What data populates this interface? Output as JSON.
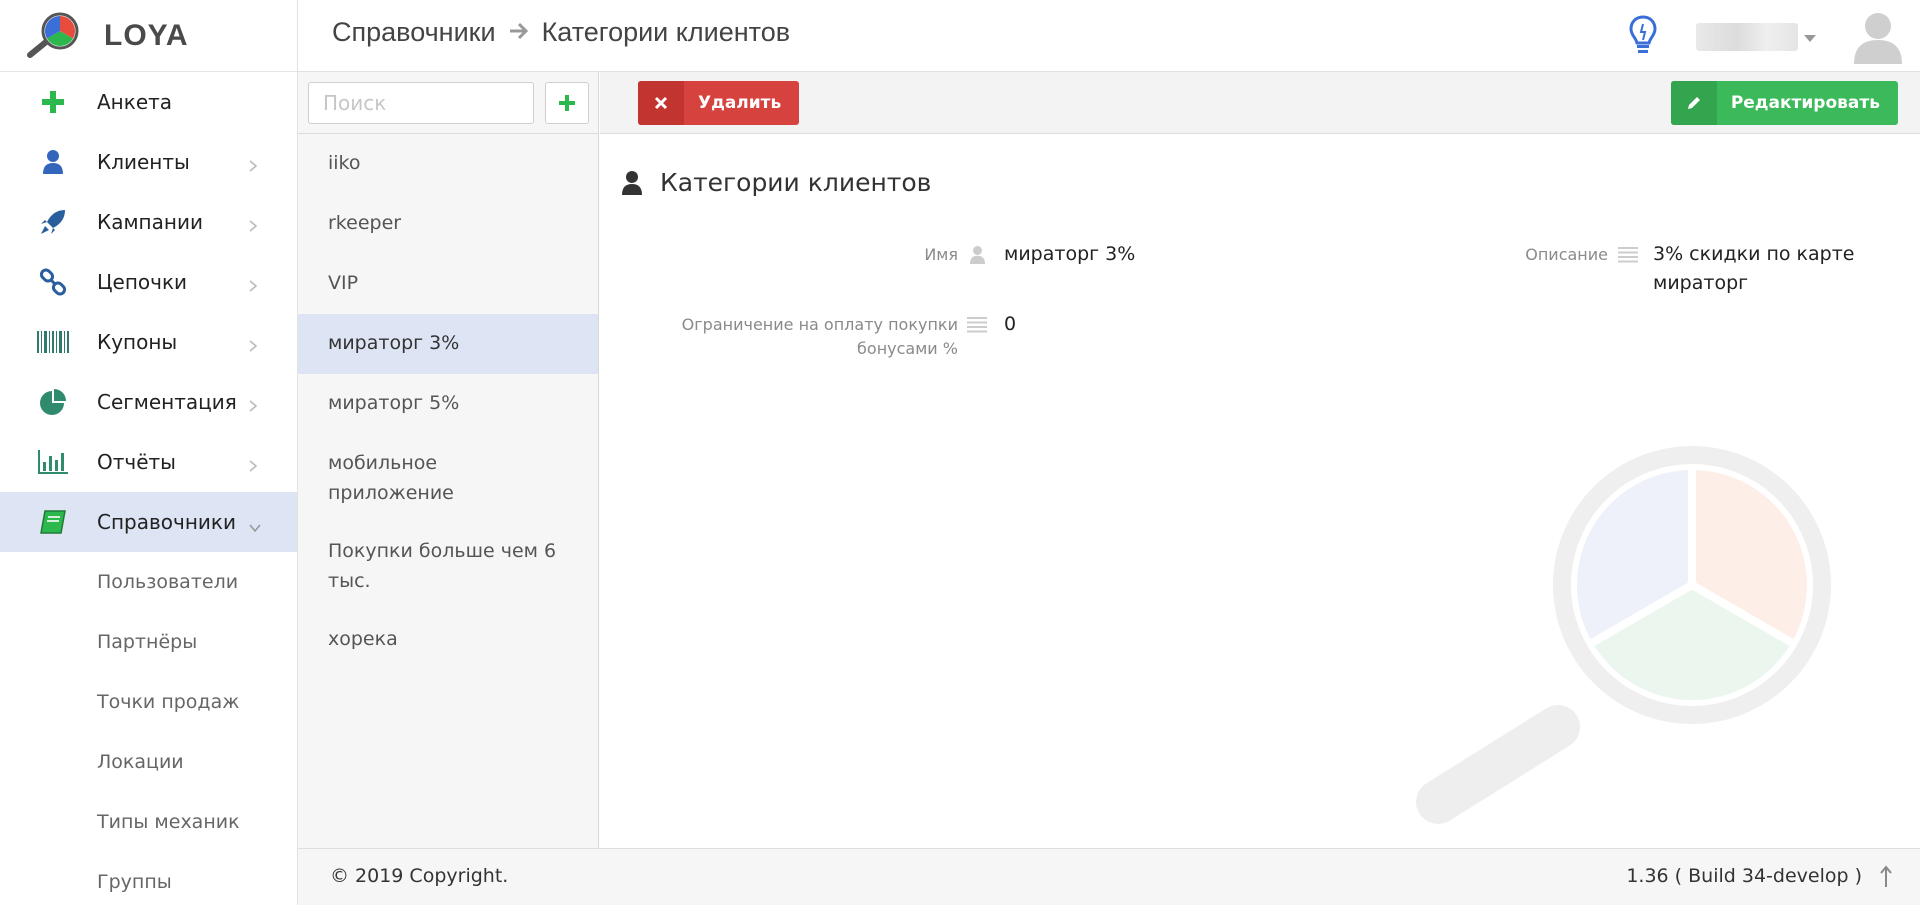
{
  "app": {
    "name": "LOYA"
  },
  "sidebar": {
    "items": [
      {
        "label": "Анкета",
        "icon": "plus-icon",
        "color": "#2db84d",
        "has_children": false
      },
      {
        "label": "Клиенты",
        "icon": "user-icon",
        "color": "#3366bb",
        "has_children": true
      },
      {
        "label": "Кампании",
        "icon": "rocket-icon",
        "color": "#2a5f9e",
        "has_children": true
      },
      {
        "label": "Цепочки",
        "icon": "link-icon",
        "color": "#2a5f9e",
        "has_children": true
      },
      {
        "label": "Купоны",
        "icon": "barcode-icon",
        "color": "#2f7a6e",
        "has_children": true
      },
      {
        "label": "Сегментация",
        "icon": "pie-chart-icon",
        "color": "#2f8a6e",
        "has_children": true
      },
      {
        "label": "Отчёты",
        "icon": "bar-chart-icon",
        "color": "#2f8a6e",
        "has_children": true
      },
      {
        "label": "Справочники",
        "icon": "book-icon",
        "color": "#2db84d",
        "has_children": true,
        "expanded": true
      }
    ],
    "subitems": [
      {
        "label": "Пользователи"
      },
      {
        "label": "Партнёры"
      },
      {
        "label": "Точки продаж"
      },
      {
        "label": "Локации"
      },
      {
        "label": "Типы механик"
      },
      {
        "label": "Группы"
      }
    ]
  },
  "header": {
    "breadcrumb": [
      "Справочники",
      "Категории клиентов"
    ]
  },
  "list": {
    "search_placeholder": "Поиск",
    "items": [
      {
        "label": "iiko"
      },
      {
        "label": "rkeeper"
      },
      {
        "label": "VIP"
      },
      {
        "label": "мираторг 3%",
        "selected": true
      },
      {
        "label": "мираторг 5%"
      },
      {
        "label": "мобильное приложение"
      },
      {
        "label": "Покупки больше чем 6 тыс."
      },
      {
        "label": "хорека"
      }
    ]
  },
  "toolbar": {
    "delete_label": "Удалить",
    "edit_label": "Редактировать"
  },
  "detail": {
    "title": "Категории клиентов",
    "fields": {
      "name": {
        "label": "Имя",
        "value": "мираторг 3%"
      },
      "description": {
        "label": "Описание",
        "value": "3% скидки по карте мираторг"
      },
      "limit": {
        "label": "Ограничение на оплату покупки бонусами %",
        "value": "0"
      }
    }
  },
  "footer": {
    "copyright": "© 2019 Copyright.",
    "version": "1.36 ( Build 34-develop )"
  },
  "colors": {
    "accent": "#2db84d",
    "danger": "#d6433e",
    "selected_bg": "#dde4f4"
  }
}
